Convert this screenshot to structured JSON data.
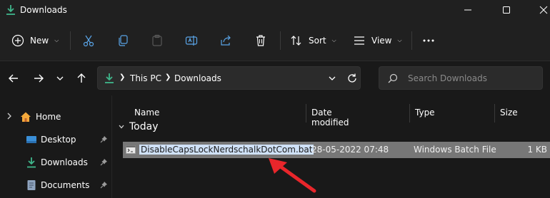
{
  "window": {
    "title": "Downloads",
    "controls": {
      "minimize": "minimize-icon",
      "maximize": "maximize-icon",
      "close": "close-icon"
    }
  },
  "toolbar": {
    "new_label": "New",
    "sort_label": "Sort",
    "view_label": "View",
    "icons": [
      "plus-circle-icon",
      "cut-icon",
      "copy-icon",
      "paste-icon",
      "rename-icon",
      "share-icon",
      "delete-icon",
      "sort-icon",
      "view-icon",
      "more-icon"
    ]
  },
  "nav": {
    "breadcrumb": [
      "This PC",
      "Downloads"
    ],
    "search_placeholder": "Search Downloads"
  },
  "sidebar": {
    "items": [
      {
        "label": "Home",
        "icon": "home-icon"
      },
      {
        "label": "Desktop",
        "icon": "desktop-icon"
      },
      {
        "label": "Downloads",
        "icon": "download-icon"
      },
      {
        "label": "Documents",
        "icon": "document-icon"
      }
    ]
  },
  "columns": [
    "Name",
    "Date modified",
    "Type",
    "Size"
  ],
  "groups": [
    {
      "label": "Today",
      "files": [
        {
          "name": "DisableCapsLockNerdschalkDotCom.bat",
          "date": "28-05-2022 07:48",
          "type": "Windows Batch File",
          "size": "1 KB"
        }
      ]
    }
  ],
  "colors": {
    "accent": "#3fb68b",
    "background": "#191919",
    "selection": "#777777",
    "annotation": "#e8262b"
  }
}
